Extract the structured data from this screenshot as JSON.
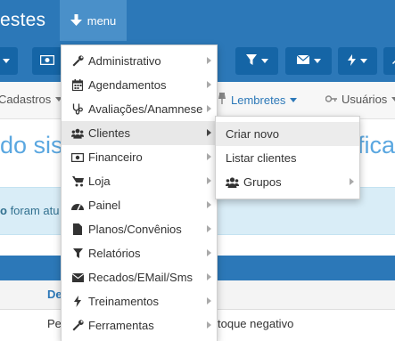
{
  "navbar": {
    "brand": "estes",
    "menu_label": "menu"
  },
  "tabs": [
    {
      "label": "Cadastros"
    },
    {
      "label": "Lembretes"
    },
    {
      "label": "Usuários"
    }
  ],
  "welcome": {
    "left": "do sist",
    "right": "ficad"
  },
  "alert": {
    "strong": "o",
    "text": " foram atu"
  },
  "table": {
    "header_col": "De",
    "row1_col1": "Pe",
    "row1_col2": "toque negativo"
  },
  "dropdown": {
    "items": [
      {
        "label": "Administrativo",
        "icon": "wrench-icon"
      },
      {
        "label": "Agendamentos",
        "icon": "calendar-icon"
      },
      {
        "label": "Avaliações/Anamnese",
        "icon": "stethoscope-icon"
      },
      {
        "label": "Clientes",
        "icon": "users-icon"
      },
      {
        "label": "Financeiro",
        "icon": "money-icon"
      },
      {
        "label": "Loja",
        "icon": "cart-icon"
      },
      {
        "label": "Painel",
        "icon": "dashboard-icon"
      },
      {
        "label": "Planos/Convênios",
        "icon": "file-icon"
      },
      {
        "label": "Relatórios",
        "icon": "filter-icon"
      },
      {
        "label": "Recados/EMail/Sms",
        "icon": "envelope-icon"
      },
      {
        "label": "Treinamentos",
        "icon": "bolt-icon"
      },
      {
        "label": "Ferramentas",
        "icon": "wrench-icon"
      }
    ]
  },
  "submenu": {
    "items": [
      {
        "label": "Criar novo"
      },
      {
        "label": "Listar clientes"
      },
      {
        "label": "Grupos",
        "icon": "users-icon"
      }
    ]
  },
  "colors": {
    "navbar": "#2c78b8",
    "menu_active": "#4a90c9",
    "toolbar_button": "#1565a6",
    "heading": "#5aa7e0",
    "alert_bg": "#d9edf7",
    "alert_text": "#31708f"
  }
}
